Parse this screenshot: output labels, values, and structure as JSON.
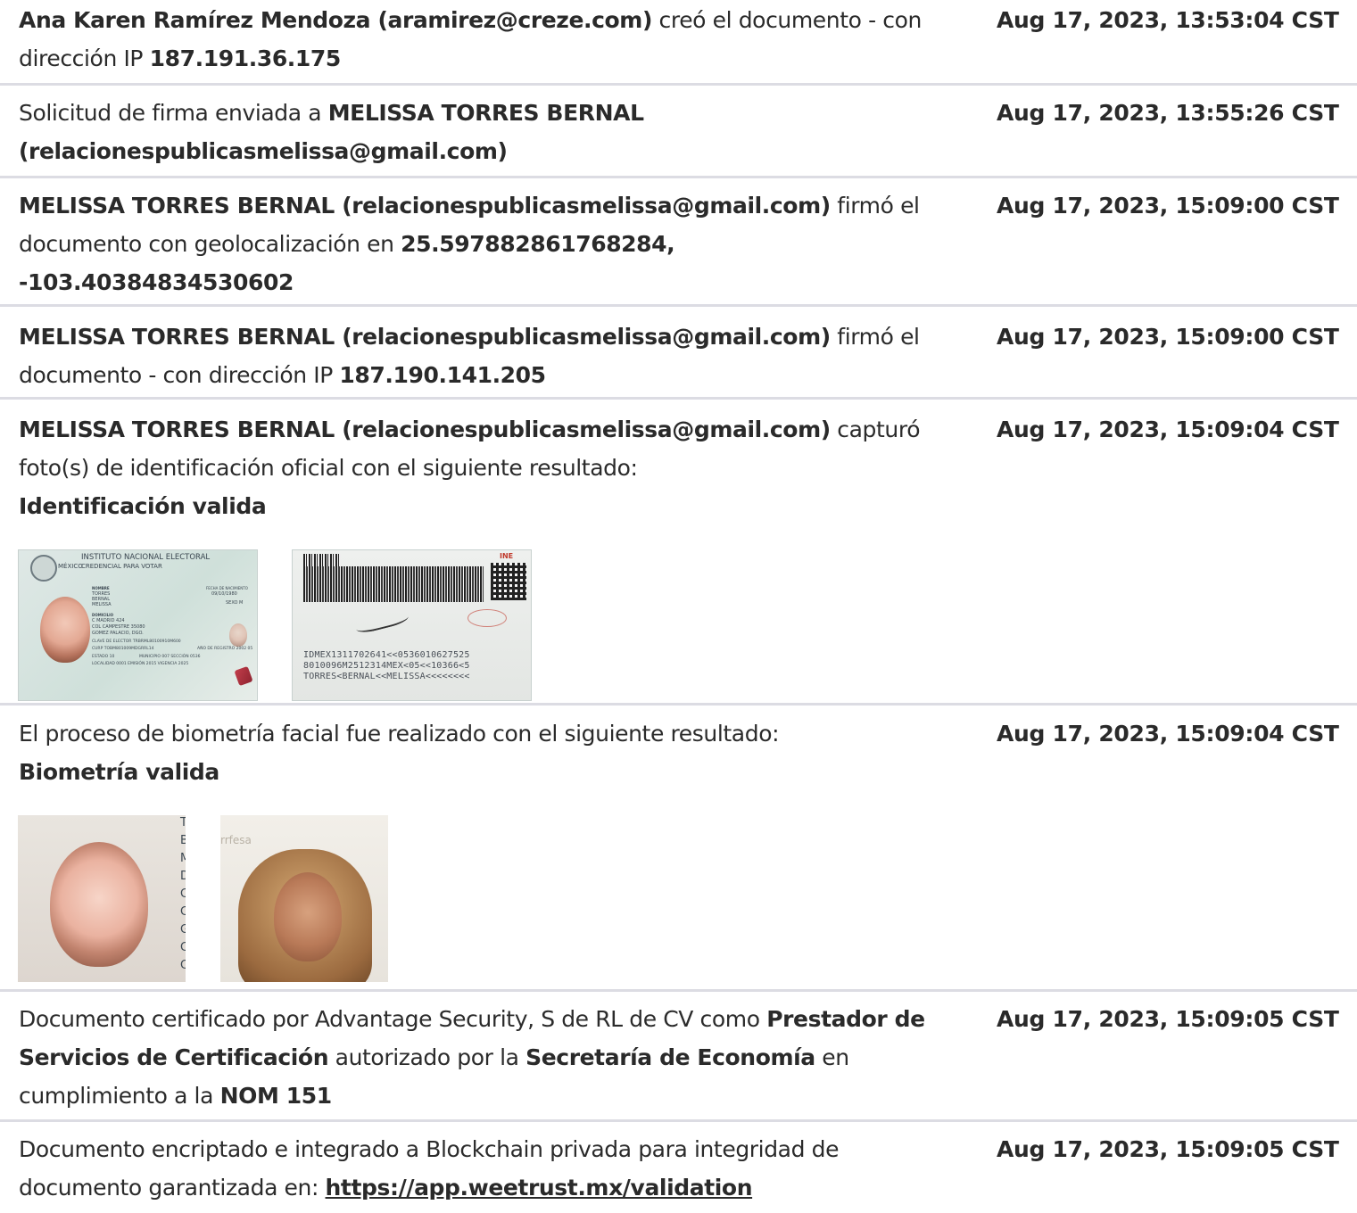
{
  "entries": [
    {
      "parts": [
        {
          "t": "Ana Karen Ramírez Mendoza (aramirez@creze.com)",
          "b": true
        },
        {
          "t": " creó el documento - con dirección IP ",
          "b": false
        },
        {
          "t": "187.191.36.175",
          "b": true
        }
      ],
      "timestamp": "Aug 17, 2023, 13:53:04 CST"
    },
    {
      "parts": [
        {
          "t": "Solicitud de firma enviada a ",
          "b": false
        },
        {
          "t": "MELISSA TORRES BERNAL (relacionespublicasmelissa@gmail.com)",
          "b": true
        }
      ],
      "timestamp": "Aug 17, 2023, 13:55:26 CST"
    },
    {
      "parts": [
        {
          "t": "MELISSA TORRES BERNAL (relacionespublicasmelissa@gmail.com)",
          "b": true
        },
        {
          "t": " firmó el documento con geolocalización en ",
          "b": false
        },
        {
          "t": "25.597882861768284, -103.40384834530602",
          "b": true
        }
      ],
      "timestamp": "Aug 17, 2023, 15:09:00 CST"
    },
    {
      "parts": [
        {
          "t": "MELISSA TORRES BERNAL (relacionespublicasmelissa@gmail.com)",
          "b": true
        },
        {
          "t": " firmó el documento - con dirección IP ",
          "b": false
        },
        {
          "t": "187.190.141.205",
          "b": true
        }
      ],
      "timestamp": "Aug 17, 2023, 15:09:00 CST"
    },
    {
      "parts": [
        {
          "t": "MELISSA TORRES BERNAL (relacionespublicasmelissa@gmail.com)",
          "b": true
        },
        {
          "t": " capturó foto(s) de identificación oficial con el siguiente resultado: ",
          "b": false
        },
        {
          "t": "Identificación valida",
          "b": true,
          "br": true
        }
      ],
      "timestamp": "Aug 17, 2023, 15:09:04 CST"
    },
    {
      "parts": [
        {
          "t": "El proceso de biometría facial fue realizado con el siguiente resultado: ",
          "b": false
        },
        {
          "t": "Biometría valida",
          "b": true,
          "br": true
        }
      ],
      "timestamp": "Aug 17, 2023, 15:09:04 CST"
    },
    {
      "parts": [
        {
          "t": "Documento certificado por Advantage Security, S de RL de CV como ",
          "b": false
        },
        {
          "t": "Prestador de Servicios de Certificación",
          "b": true
        },
        {
          "t": " autorizado por la ",
          "b": false
        },
        {
          "t": "Secretaría de Economía",
          "b": true
        },
        {
          "t": " en cumplimiento a la ",
          "b": false
        },
        {
          "t": "NOM 151",
          "b": true
        }
      ],
      "timestamp": "Aug 17, 2023, 15:09:05 CST"
    },
    {
      "parts": [
        {
          "t": "Documento encriptado e integrado a Blockchain privada para integridad de documento garantizada en: ",
          "b": false
        },
        {
          "t": "https://app.weetrust.mx/validation",
          "b": true,
          "link": true
        }
      ],
      "timestamp": "Aug 17, 2023, 15:09:05 CST"
    }
  ],
  "id_front": {
    "country": "MÉXICO",
    "institution": "INSTITUTO NACIONAL ELECTORAL",
    "card_type": "CREDENCIAL PARA VOTAR",
    "name_label": "NOMBRE",
    "name_lines": [
      "TORRES",
      "BERNAL",
      "MELISSA"
    ],
    "address_label": "DOMICILIO",
    "address_lines": [
      "C MADRID 424",
      "COL CAMPESTRE 35080",
      "GOMEZ PALACIO, DGO."
    ],
    "dob_label": "FECHA DE NACIMIENTO",
    "dob": "09/10/1980",
    "sex_label": "SEXO",
    "sex": "M",
    "elector_key_label": "CLAVE DE ELECTOR",
    "elector_key": "TRBRML80100910M600",
    "curp_label": "CURP",
    "curp": "TOBM801009MDGRRL14",
    "registry_label": "AÑO DE REGISTRO",
    "registry": "2002 05",
    "state_label": "ESTADO",
    "state": "10",
    "municipality_label": "MUNICIPIO",
    "municipality": "007",
    "section_label": "SECCIÓN",
    "section": "0536",
    "locality_label": "LOCALIDAD",
    "locality": "0001",
    "issue_label": "EMISIÓN",
    "issue": "2015",
    "validity_label": "VIGENCIA",
    "validity": "2025"
  },
  "id_back": {
    "brand": "INE",
    "mrz": [
      "IDMEX1311702641<<0536010627525",
      "8010096M2512314MEX<05<<10366<5",
      "TORRES<BERNAL<<MELISSA<<<<<<<<"
    ]
  },
  "face_id_letters": [
    "T",
    "B",
    "M",
    "D",
    "C",
    "C",
    "G",
    "C",
    "C"
  ],
  "selfie_text": "rrfesa"
}
